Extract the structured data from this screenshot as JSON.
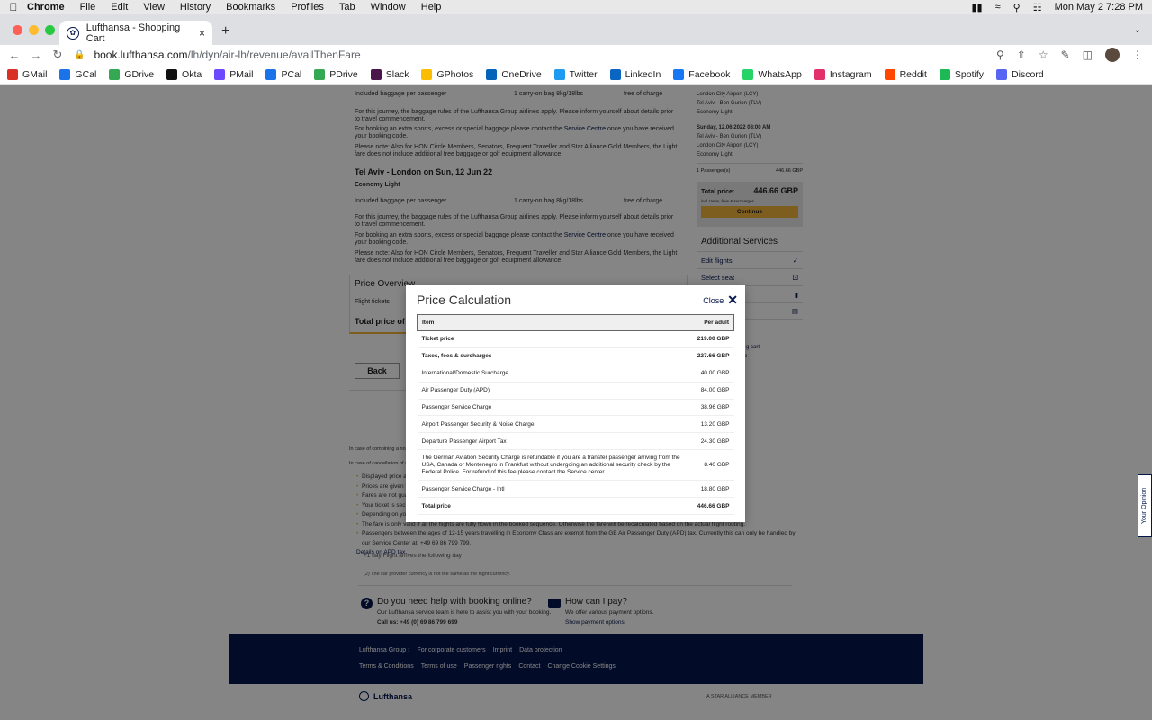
{
  "menubar": {
    "app": "Chrome",
    "items": [
      "File",
      "Edit",
      "View",
      "History",
      "Bookmarks",
      "Profiles",
      "Tab",
      "Window",
      "Help"
    ],
    "clock": "Mon May 2  7:28 PM"
  },
  "tab": {
    "title": "Lufthansa - Shopping Cart"
  },
  "address": {
    "host": "book.lufthansa.com",
    "path": "/lh/dyn/air-lh/revenue/availThenFare"
  },
  "bookmarks": [
    {
      "label": "GMail",
      "color": "#d93025"
    },
    {
      "label": "GCal",
      "color": "#1a73e8"
    },
    {
      "label": "GDrive",
      "color": "#34a853"
    },
    {
      "label": "Okta",
      "color": "#111111"
    },
    {
      "label": "PMail",
      "color": "#6d4aff"
    },
    {
      "label": "PCal",
      "color": "#1a73e8"
    },
    {
      "label": "PDrive",
      "color": "#34a853"
    },
    {
      "label": "Slack",
      "color": "#4a154b"
    },
    {
      "label": "GPhotos",
      "color": "#fbbc04"
    },
    {
      "label": "OneDrive",
      "color": "#0364b8"
    },
    {
      "label": "Twitter",
      "color": "#1d9bf0"
    },
    {
      "label": "LinkedIn",
      "color": "#0a66c2"
    },
    {
      "label": "Facebook",
      "color": "#1877f2"
    },
    {
      "label": "WhatsApp",
      "color": "#25d366"
    },
    {
      "label": "Instagram",
      "color": "#e1306c"
    },
    {
      "label": "Reddit",
      "color": "#ff4500"
    },
    {
      "label": "Spotify",
      "color": "#1db954"
    },
    {
      "label": "Discord",
      "color": "#5865f2"
    }
  ],
  "bg": {
    "bag1_label": "Included baggage per passenger",
    "bag1_val": "1 carry-on bag 8kg/18lbs",
    "bag1_fee": "free of charge",
    "rules1": "For this journey, the baggage rules of the Lufthansa Group airlines apply. Please inform yourself about details prior to travel commencement.",
    "sports1a": "For booking an extra sports, excess or special baggage please contact the",
    "service_centre": "Service Centre",
    "sports1b": "once you have received your booking code.",
    "note1": "Please note: Also for HON Circle Members, Senators, Frequent Traveller and Star Alliance Gold Members, the Light fare does not include additional free baggage or golf equipment allowance.",
    "leg2_title": "Tel Aviv - London on Sun, 12 Jun 22",
    "leg2_class": "Economy Light",
    "price_overview": "Price Overview",
    "flight_tickets": "Flight tickets",
    "total_price_of": "Total price of y",
    "back": "Back",
    "combining": "In case of combining a non",
    "cancellation": "In case of cancellation of a",
    "bullets": [
      "Displayed price a",
      "Prices are given f",
      "Fares are not gua",
      "Your ticket is sec",
      "Depending on yo",
      "The fare is only valid if all the flights are fully flown in the booked sequence. Otherwise the fare will be recalculated based on the actual flight routing.",
      "Passengers between the ages of 12-15 years travelling in Economy Class are exempt from the GB Air Passenger Duty (APD) tax. Currently this can only be handled by our Service Center at: +49 69 86 799 799."
    ],
    "apd_link": "Details on APD tax.",
    "plus1": "+1 day Flight arrives the following day",
    "car_note": "(2) The car provider currency is not the same as the flight currency.",
    "help_title": "Do you need help with booking online?",
    "help_text": "Our Lufthansa service team is here to assist you with your booking.",
    "help_call": "Call us: +49 (0) 69 86 799 699",
    "pay_title": "How can I pay?",
    "pay_text": "We offer various payment options.",
    "pay_link": "Show payment options",
    "footer_row1": [
      "Lufthansa Group ›",
      "For corporate customers",
      "Imprint",
      "Data protection"
    ],
    "footer_row2": [
      "Terms & Conditions",
      "Terms of use",
      "Passenger rights",
      "Contact",
      "Change Cookie Settings"
    ],
    "brand": "Lufthansa",
    "star": "A STAR ALLIANCE MEMBER",
    "feedback": "Your Opinion"
  },
  "sidebar": {
    "lines": [
      "London City Airport (LCY)",
      "Tel Aviv - Ben Gurion (TLV)",
      "Economy Light"
    ],
    "date2": "Sunday, 12.06.2022 08:00 AM",
    "lines2": [
      "Tel Aviv - Ben Gurion (TLV)",
      "London City Airport (LCY)",
      "Economy Light"
    ],
    "passengers": "1 Passenger(s)",
    "passengers_amt": "446.66 GBP",
    "total_label": "Total price:",
    "total_amt": "446.66 GBP",
    "incl": "incl. taxes, fees & surcharges",
    "continue": "Continue",
    "additional": "Additional Services",
    "edit_flights": "Edit flights",
    "seat_partial": "Select seat",
    "cart_partial": "g cart",
    "re_partial": "re"
  },
  "modal": {
    "title": "Price Calculation",
    "close": "Close",
    "col_item": "Item",
    "col_per": "Per adult",
    "rows": [
      {
        "label": "Ticket price",
        "amount": "219.00 GBP",
        "bold": true
      },
      {
        "label": "Taxes, fees & surcharges",
        "amount": "227.66 GBP",
        "bold": true
      },
      {
        "label": "International/Domestic Surcharge",
        "amount": "40.00 GBP"
      },
      {
        "label": "Air Passenger Duty (APD)",
        "amount": "84.00 GBP"
      },
      {
        "label": "Passenger Service Charge",
        "amount": "38.96 GBP"
      },
      {
        "label": "Airport Passenger Security & Noise Charge",
        "amount": "13.20 GBP"
      },
      {
        "label": "Departure Passenger Airport Tax",
        "amount": "24.30 GBP"
      },
      {
        "label": "The German Aviation Security Charge is refundable if you are a transfer passenger arriving from the USA, Canada or Montenegro in Frankfurt without undergoing an additional security check by the Federal Police. For refund of this fee please contact the Service center",
        "amount": "8.40 GBP",
        "tall": true
      },
      {
        "label": "Passenger Service Charge - Intl",
        "amount": "18.80 GBP"
      },
      {
        "label": "Total price",
        "amount": "446.66 GBP",
        "bold": true
      }
    ]
  }
}
